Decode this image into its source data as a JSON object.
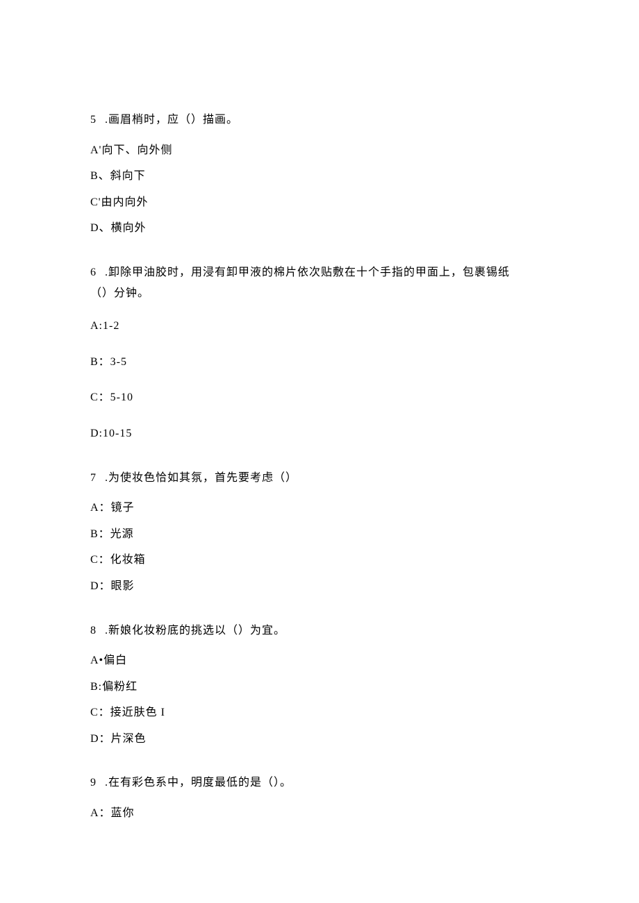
{
  "questions": [
    {
      "number": "5",
      "stem": ".画眉梢时，应（）描画。",
      "options": [
        "A'向下、向外侧",
        "B、斜向下",
        "C'由内向外",
        "D、横向外"
      ]
    },
    {
      "number": "6",
      "stem": ".卸除甲油胶时，用浸有卸甲液的棉片依次贴敷在十个手指的甲面上，包裹锡纸",
      "stem2": "（）分钟。",
      "options": [
        "A:1-2",
        "B：3-5",
        "C：5-10",
        "D:10-15"
      ]
    },
    {
      "number": "7",
      "stem": ".为使妆色恰如其氛，首先要考虑（）",
      "options": [
        "A：镜子",
        "B：光源",
        "C：化妆箱",
        "D：眼影"
      ]
    },
    {
      "number": "8",
      "stem": ".新娘化妆粉底的挑选以（）为宜。",
      "options": [
        "A•偏白",
        "B:偏粉红",
        "C：接近肤色 I",
        "D：片深色"
      ]
    },
    {
      "number": "9",
      "stem": ".在有彩色系中，明度最低的是（）。",
      "options": [
        "A：蓝你"
      ]
    }
  ]
}
